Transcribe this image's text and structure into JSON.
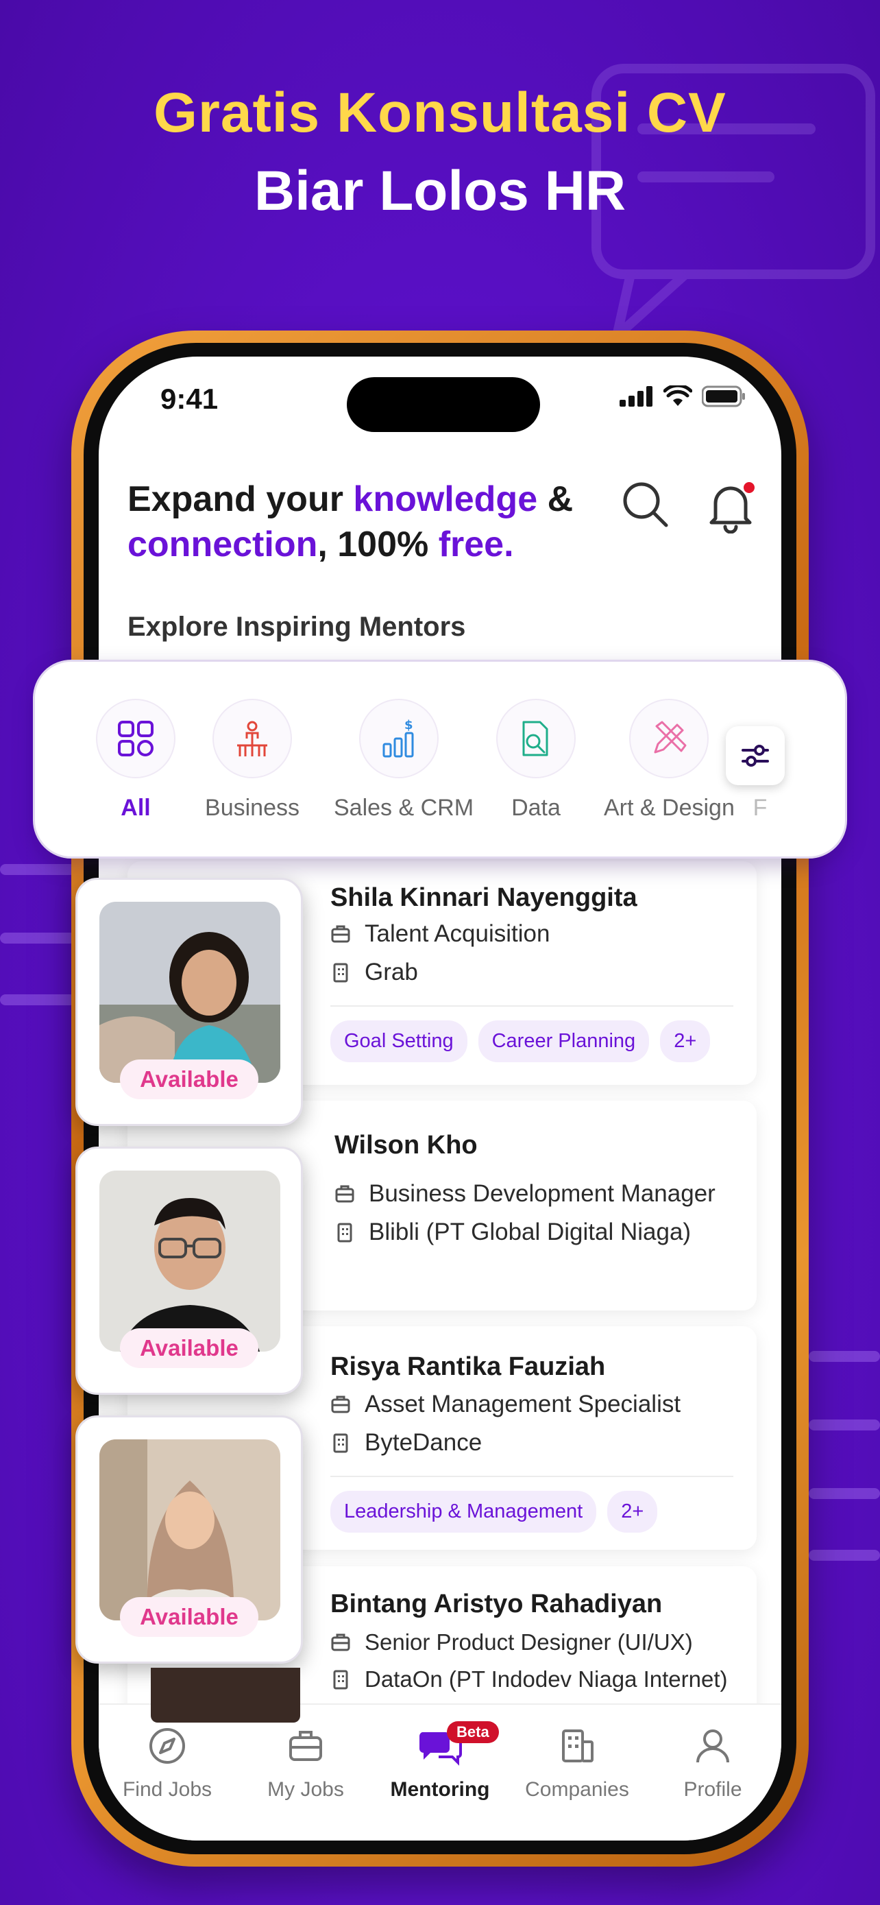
{
  "banner": {
    "line1": "Gratis Konsultasi CV",
    "line2": "Biar Lolos HR"
  },
  "status_bar": {
    "time": "9:41"
  },
  "header": {
    "part1": "Expand your ",
    "accent1": "knowledge",
    "part2": " &",
    "accent2": "connection",
    "part3": ", 100% ",
    "accent3": "free."
  },
  "explore_title": "Explore Inspiring Mentors",
  "categories": [
    {
      "label": "All",
      "icon": "grid-icon",
      "active": true
    },
    {
      "label": "Business",
      "icon": "business-people-icon"
    },
    {
      "label": "Sales & CRM",
      "icon": "sales-chart-icon"
    },
    {
      "label": "Data",
      "icon": "data-search-icon"
    },
    {
      "label": "Art & Design",
      "icon": "pencil-ruler-icon"
    },
    {
      "label": "F"
    }
  ],
  "mentors": [
    {
      "name": "Shila Kinnari Nayenggita",
      "role": "Talent Acquisition",
      "company": "Grab",
      "tags": [
        "Goal Setting",
        "Career Planning",
        "2+"
      ],
      "status": "Available"
    },
    {
      "name": "Wilson Kho",
      "role": "Business Development Manager",
      "company": "Blibli (PT Global Digital Niaga)",
      "tags": [],
      "status": "Available"
    },
    {
      "name": "Risya Rantika Fauziah",
      "role": "Asset Management Specialist",
      "company": "ByteDance",
      "tags": [
        "Leadership & Management",
        "2+"
      ],
      "status": "Available"
    },
    {
      "name": "Bintang Aristyo Rahadiyan",
      "role": "Senior Product Designer (UI/UX)",
      "company": "DataOn (PT Indodev Niaga Internet)",
      "tags": []
    }
  ],
  "bottom_nav": [
    {
      "label": "Find Jobs",
      "icon": "compass-icon"
    },
    {
      "label": "My Jobs",
      "icon": "briefcase-icon"
    },
    {
      "label": "Mentoring",
      "icon": "chat-bubbles-icon",
      "active": true,
      "badge": "Beta"
    },
    {
      "label": "Companies",
      "icon": "building-icon"
    },
    {
      "label": "Profile",
      "icon": "person-icon"
    }
  ],
  "colors": {
    "brand_purple": "#6a12d8",
    "banner_yellow": "#ffd84a",
    "available_pink": "#e0388c",
    "notification_red": "#e4142a"
  }
}
